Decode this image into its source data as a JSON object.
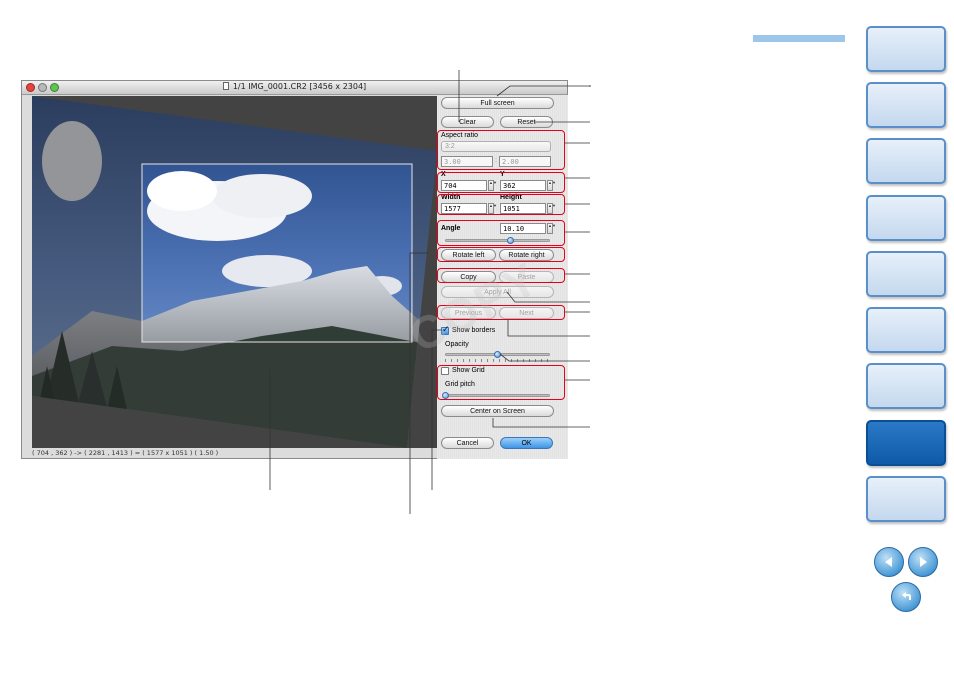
{
  "window": {
    "title": "1/1 IMG_0001.CR2 [3456 x 2304]",
    "status": "( 704 , 362 ) -> ( 2281 , 1413 ) = ( 1577 x 1051 ) ( 1.50 )"
  },
  "panel": {
    "full_screen_label": "Full screen",
    "clear_label": "Clear",
    "reset_label": "Reset",
    "aspect_ratio_label": "Aspect ratio",
    "aspect_ratio_value": "3:2",
    "ratio_w": "3.00",
    "ratio_sep": ":",
    "ratio_h": "2.00",
    "x_label": "X",
    "x_value": "704",
    "y_label": "Y",
    "y_value": "362",
    "width_label": "Width",
    "width_value": "1577",
    "height_label": "Height",
    "height_value": "1051",
    "angle_label": "Angle",
    "angle_value": "10.10",
    "angle_level": 0.62,
    "rotate_left_label": "Rotate left",
    "rotate_right_label": "Rotate right",
    "copy_label": "Copy",
    "paste_label": "Paste",
    "apply_all_label": "Apply All",
    "previous_label": "Previous",
    "next_label": "Next",
    "show_borders_label": "Show borders",
    "show_borders_checked": true,
    "opacity_label": "Opacity",
    "opacity_level": 0.5,
    "show_grid_label": "Show Grid",
    "show_grid_checked": false,
    "grid_pitch_label": "Grid pitch",
    "grid_pitch_level": 0.0,
    "center_label": "Center on Screen",
    "cancel_label": "Cancel",
    "ok_label": "OK"
  },
  "page": {
    "watermark": "COPY"
  },
  "icons": {
    "prev": "arrow-left-icon",
    "next": "arrow-right-icon",
    "back": "return-icon"
  },
  "colors": {
    "highlight": "#e4001b",
    "side_tab": "#c4d8ee",
    "side_tab_active": "#0e5aa8",
    "accent": "#9cc6ea"
  }
}
